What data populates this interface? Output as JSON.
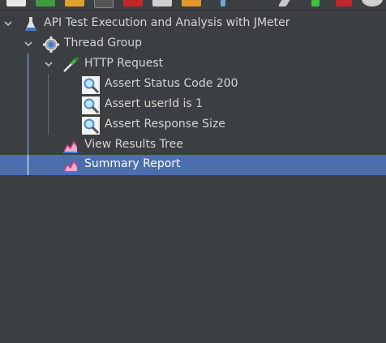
{
  "toolbar": {
    "icons": [
      "new-icon",
      "templates-icon",
      "open-icon",
      "save-icon",
      "cut-icon",
      "copy-icon",
      "paste-icon",
      "expand-icon",
      "clear-icon",
      "start-icon",
      "start-no-pause-icon",
      "stop-icon"
    ]
  },
  "tree": {
    "root": {
      "label": "API Test Execution and Analysis with JMeter",
      "icon": "flask-icon"
    },
    "thread_group": {
      "label": "Thread Group",
      "icon": "gear-icon"
    },
    "http_request": {
      "label": "HTTP Request",
      "icon": "pipette-icon"
    },
    "assertions": [
      {
        "label": "Assert Status Code 200",
        "icon": "magnifier-icon"
      },
      {
        "label": "Assert userId is 1",
        "icon": "magnifier-icon"
      },
      {
        "label": "Assert Response Size",
        "icon": "magnifier-icon"
      }
    ],
    "view_results_tree": {
      "label": "View Results Tree",
      "icon": "chart-icon"
    },
    "summary_report": {
      "label": "Summary Report",
      "icon": "chart-icon",
      "selected": true
    }
  },
  "colors": {
    "background": "#3c3f41",
    "selection": "#4b6eaf",
    "text": "#d4d4d4",
    "tree_line": "#8ab4f8"
  }
}
